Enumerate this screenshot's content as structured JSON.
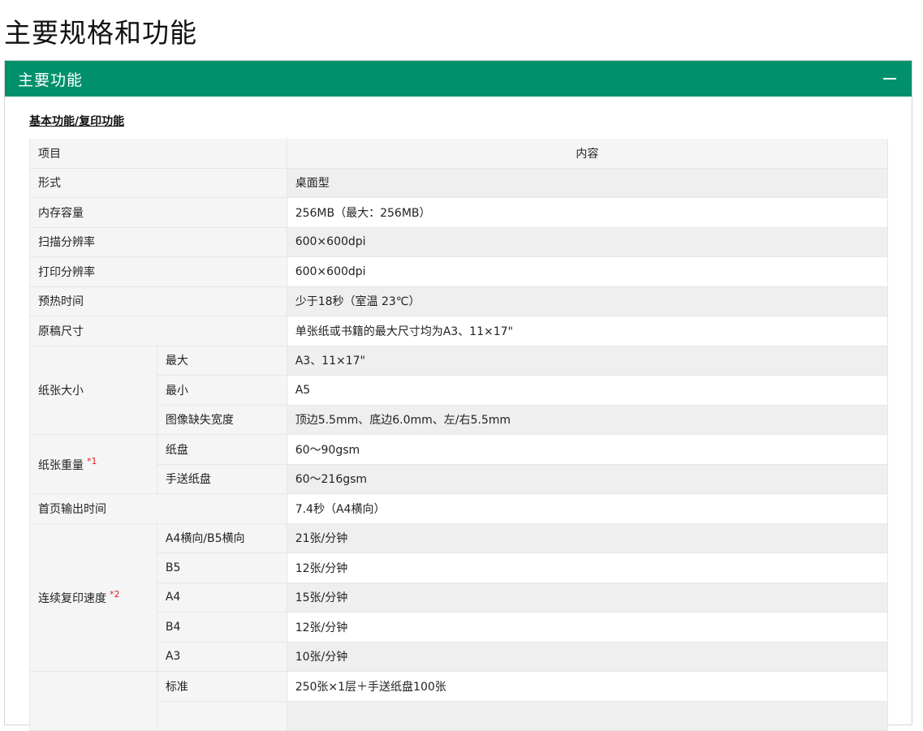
{
  "page": {
    "title": "主要规格和功能"
  },
  "panel": {
    "title": "主要功能",
    "collapse_icon": "minus-icon"
  },
  "section": {
    "heading": "基本功能/复印功能"
  },
  "table": {
    "header": {
      "item": "项目",
      "content": "内容"
    },
    "rows": {
      "form": {
        "label": "形式",
        "value": "桌面型"
      },
      "memory": {
        "label": "内存容量",
        "value": "256MB（最大：256MB）"
      },
      "scan_res": {
        "label": "扫描分辨率",
        "value": "600×600dpi"
      },
      "print_res": {
        "label": "打印分辨率",
        "value": "600×600dpi"
      },
      "warmup": {
        "label": "预热时间",
        "value": "少于18秒（室温 23℃）"
      },
      "original_size": {
        "label": "原稿尺寸",
        "value": "单张纸或书籍的最大尺寸均为A3、11×17\""
      },
      "paper_size": {
        "label": "纸张大小",
        "max": {
          "label": "最大",
          "value": "A3、11×17\""
        },
        "min": {
          "label": "最小",
          "value": "A5"
        },
        "loss": {
          "label": "图像缺失宽度",
          "value": "顶边5.5mm、底边6.0mm、左/右5.5mm"
        }
      },
      "paper_weight": {
        "label": "纸张重量",
        "note": "*1",
        "tray": {
          "label": "纸盘",
          "value": "60～90gsm"
        },
        "bypass": {
          "label": "手送纸盘",
          "value": "60～216gsm"
        }
      },
      "first_copy": {
        "label": "首页输出时间",
        "value": "7.4秒（A4横向）"
      },
      "copy_speed": {
        "label": "连续复印速度",
        "note": "*2",
        "a4l_b5l": {
          "label": "A4横向/B5横向",
          "value": "21张/分钟"
        },
        "b5": {
          "label": "B5",
          "value": "12张/分钟"
        },
        "a4": {
          "label": "A4",
          "value": "15张/分钟"
        },
        "b4": {
          "label": "B4",
          "value": "12张/分钟"
        },
        "a3": {
          "label": "A3",
          "value": "10张/分钟"
        }
      },
      "paper_capacity": {
        "standard": {
          "label": "标准",
          "value": "250张×1层＋手送纸盘100张"
        }
      }
    }
  }
}
